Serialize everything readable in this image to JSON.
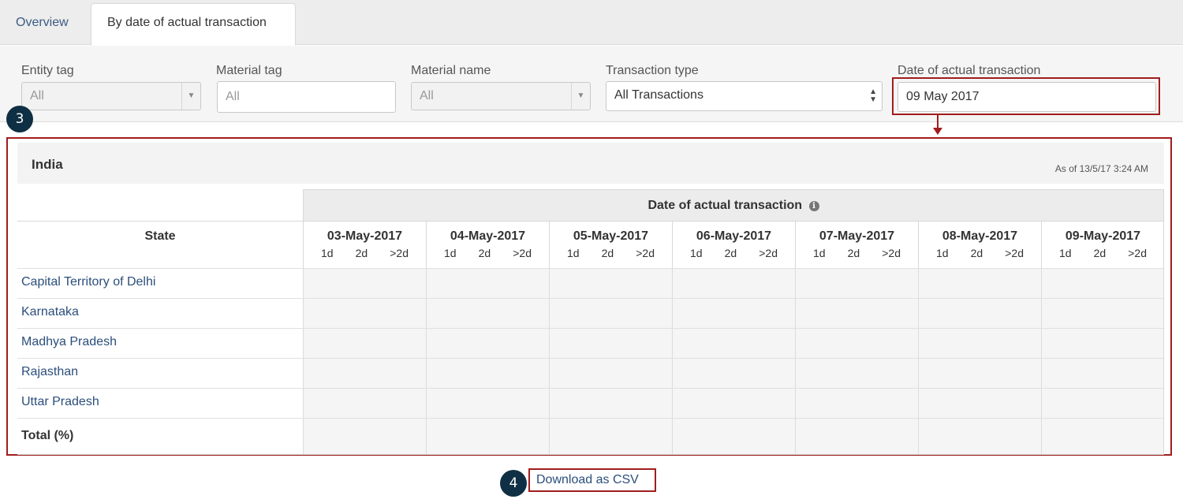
{
  "tabs": [
    {
      "label": "Overview",
      "active": false
    },
    {
      "label": "By date of actual transaction",
      "active": true
    }
  ],
  "filters": {
    "entity_tag": {
      "label": "Entity tag",
      "value": "All"
    },
    "material_tag": {
      "label": "Material tag",
      "placeholder": "All"
    },
    "material_name": {
      "label": "Material name",
      "value": "All"
    },
    "transaction_type": {
      "label": "Transaction type",
      "value": "All Transactions"
    },
    "date": {
      "label": "Date of actual transaction",
      "value": "09 May 2017"
    }
  },
  "annotations": {
    "step3": "3",
    "step4": "4",
    "highlight_color": "#a11d1d"
  },
  "panel": {
    "title": "India",
    "as_of": "As of 13/5/17 3:24 AM"
  },
  "table": {
    "group_header": "Date of actual transaction",
    "state_header": "State",
    "dates": [
      "03-May-2017",
      "04-May-2017",
      "05-May-2017",
      "06-May-2017",
      "07-May-2017",
      "08-May-2017",
      "09-May-2017"
    ],
    "subcols": [
      "1d",
      "2d",
      ">2d"
    ],
    "rows": [
      "Capital Territory of Delhi",
      "Karnataka",
      "Madhya Pradesh",
      "Rajasthan",
      "Uttar Pradesh"
    ],
    "total_label": "Total (%)"
  },
  "download": {
    "label": "Download as CSV"
  },
  "icons": {
    "info": "info-icon",
    "dropdown": "chevron-down-icon",
    "sort": "updown-arrows-icon"
  }
}
